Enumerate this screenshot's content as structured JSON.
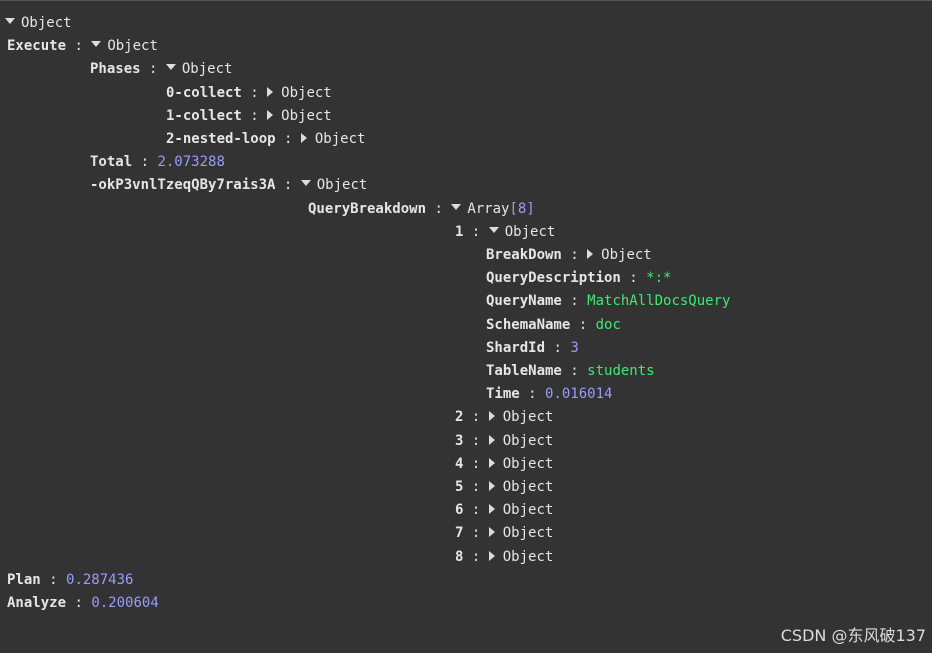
{
  "tree": {
    "root": {
      "type": "Object"
    },
    "execute": {
      "key": "Execute",
      "type": "Object"
    },
    "phases": {
      "key": "Phases",
      "type": "Object"
    },
    "phase0": {
      "key": "0-collect",
      "type": "Object"
    },
    "phase1": {
      "key": "1-collect",
      "type": "Object"
    },
    "phase2": {
      "key": "2-nested-loop",
      "type": "Object"
    },
    "total": {
      "key": "Total",
      "value": "2.073288"
    },
    "node": {
      "key": "-okP3vnlTzeqQBy7rais3A",
      "type": "Object"
    },
    "query_breakdown": {
      "key": "QueryBreakdown",
      "type": "Array",
      "count": "[8]"
    },
    "item1": {
      "key": "1",
      "type": "Object",
      "breakdown": {
        "key": "BreakDown",
        "type": "Object"
      },
      "query_description": {
        "key": "QueryDescription",
        "value": "*:*"
      },
      "query_name": {
        "key": "QueryName",
        "value": "MatchAllDocsQuery"
      },
      "schema_name": {
        "key": "SchemaName",
        "value": "doc"
      },
      "shard_id": {
        "key": "ShardId",
        "value": "3"
      },
      "table_name": {
        "key": "TableName",
        "value": "students"
      },
      "time": {
        "key": "Time",
        "value": "0.016014"
      }
    },
    "items": [
      {
        "key": "2",
        "type": "Object"
      },
      {
        "key": "3",
        "type": "Object"
      },
      {
        "key": "4",
        "type": "Object"
      },
      {
        "key": "5",
        "type": "Object"
      },
      {
        "key": "6",
        "type": "Object"
      },
      {
        "key": "7",
        "type": "Object"
      },
      {
        "key": "8",
        "type": "Object"
      }
    ],
    "plan": {
      "key": "Plan",
      "value": "0.287436"
    },
    "analyze": {
      "key": "Analyze",
      "value": "0.200604"
    }
  },
  "watermark": "CSDN @东风破137",
  "icons": {
    "expanded": "triangle-down-icon",
    "collapsed": "triangle-right-icon"
  },
  "colors": {
    "background": "#333333",
    "number": "#9b9bff",
    "string": "#3fe86f",
    "key": "#e6e6e6"
  }
}
